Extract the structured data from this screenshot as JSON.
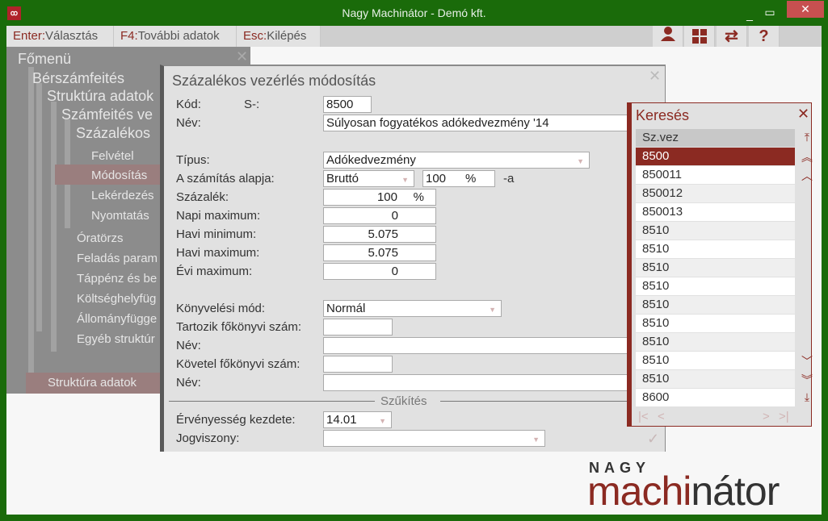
{
  "window": {
    "title": "Nagy Machinátor - Demó kft.",
    "icon": "app-logo-icon",
    "minimize": "_",
    "maximize": "▭",
    "close": "✕"
  },
  "toolbar": {
    "items": [
      {
        "key": "Enter:",
        "label": "Választás"
      },
      {
        "key": "F4:",
        "label": "További adatok"
      },
      {
        "key": "Esc:",
        "label": "Kilépés"
      }
    ],
    "icons": [
      "user-icon",
      "grid-icon",
      "swap-icon",
      "help-icon"
    ],
    "help": "?"
  },
  "menu": {
    "title": "Főmenü",
    "close": "✕",
    "level1": "Bérszámfeités",
    "level2": "Struktúra adatok",
    "level3": "Számfeités ve",
    "level4": "Százalékos",
    "actions": [
      "Felvétel",
      "Módosítás",
      "Lekérdezés",
      "Nyomtatás"
    ],
    "items": [
      "Óratörzs",
      "Feladás param",
      "Táppénz és be",
      "Költséghelyfüg",
      "Állományfügge",
      "Egyéb struktúr"
    ],
    "footer": "Struktúra adatok"
  },
  "dialog": {
    "title": "Százalékos vezérlés módosítás",
    "close": "✕",
    "confirm": "✓",
    "kod_label": "Kód:",
    "kod_prefix": "S-:",
    "kod": "8500",
    "nev_label": "Név:",
    "nev": "Súlyosan fogyatékos adókedvezmény    '14",
    "tipus_label": "Típus:",
    "tipus": "Adókedvezmény",
    "alap_label": "A számítás alapja:",
    "alap": "Bruttó",
    "alap_pct": "100",
    "pct_sign": "%",
    "alap_suffix": "-a",
    "szazalek_label": "Százalék:",
    "szazalek": "100",
    "napi_max_label": "Napi maximum:",
    "napi_max": "0",
    "havi_min_label": "Havi minimum:",
    "havi_min": "5.075",
    "havi_max_label": "Havi maximum:",
    "havi_max": "5.075",
    "evi_max_label": "Évi maximum:",
    "evi_max": "0",
    "konyv_mod_label": "Könyvelési mód:",
    "konyv_mod": "Normál",
    "tartozik_label": "Tartozik főkönyvi szám:",
    "tartozik": "",
    "tartozik_nev_label": "Név:",
    "tartozik_nev": "",
    "kovetel_label": "Követel főkönyvi szám:",
    "kovetel": "",
    "kovetel_nev_label": "Név:",
    "kovetel_nev": "",
    "szukites": "Szűkítés",
    "erv_label": "Érvényesség kezdete:",
    "erv": "14.01",
    "jogviszony_label": "Jogviszony:",
    "jogviszony": ""
  },
  "search": {
    "title": "Keresés",
    "close": "✕",
    "column": "Sz.vez",
    "selected_index": 0,
    "rows": [
      "8500",
      "850011",
      "850012",
      "850013",
      "8510",
      "8510",
      "8510",
      "8510",
      "8510",
      "8510",
      "8510",
      "8510",
      "8510",
      "8600"
    ],
    "nav_top": "⤒",
    "nav_pgup": "︽",
    "nav_up": "︿",
    "nav_down": "﹀",
    "nav_pgdn": "︾",
    "nav_bottom": "⤓",
    "first": "|<",
    "prev": "<",
    "next": ">",
    "last": ">|"
  },
  "logo": {
    "top": "NAGY",
    "red": "machi",
    "dark": "nátor"
  },
  "colors": {
    "accent": "#8b2a22",
    "titlebar": "#1a6b0a",
    "close": "#c75050"
  }
}
